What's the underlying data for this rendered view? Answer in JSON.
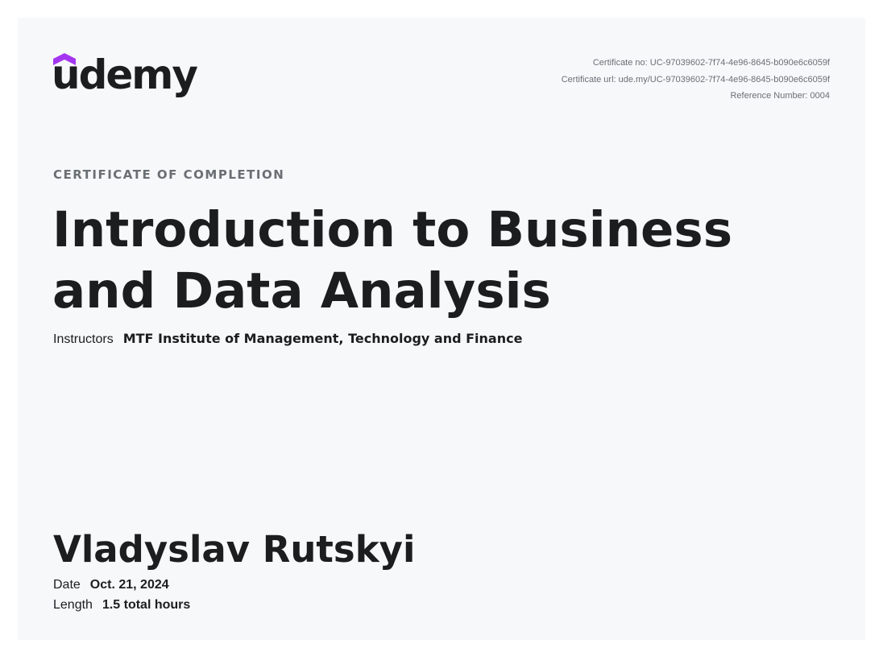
{
  "brand": {
    "name": "udemy",
    "accent_color": "#a435f0",
    "icon": "udemy-cap-icon"
  },
  "certificate_meta": {
    "certificate_no": "Certificate no: UC-97039602-7f74-4e96-8645-b090e6c6059f",
    "certificate_url": "Certificate url: ude.my/UC-97039602-7f74-4e96-8645-b090e6c6059f",
    "reference_number": "Reference Number: 0004"
  },
  "certificate": {
    "kicker": "CERTIFICATE OF COMPLETION",
    "course_title": "Introduction to Business and Data Analysis",
    "instructors_label": "Instructors",
    "instructors_value": "MTF Institute of Management, Technology and Finance",
    "recipient": "Vladyslav Rutskyi",
    "date_label": "Date",
    "date_value": "Oct. 21, 2024",
    "length_label": "Length",
    "length_value": "1.5 total hours"
  }
}
